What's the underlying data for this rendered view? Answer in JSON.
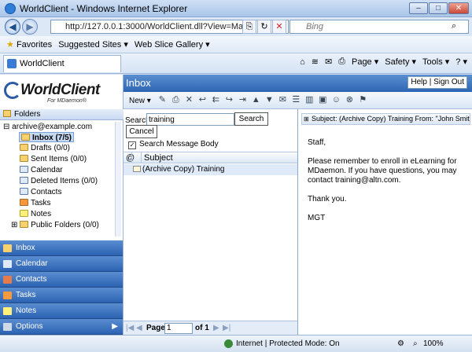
{
  "window": {
    "title": "WorldClient - Windows Internet Explorer",
    "min": "–",
    "max": "□",
    "close": "✕"
  },
  "address": {
    "url": "http://127.0.0.1:3000/WorldClient.dll?View=Main",
    "search_placeholder": "Bing"
  },
  "favorites": {
    "label": "Favorites",
    "items": [
      "Suggested Sites ▾",
      "Web Slice Gallery ▾"
    ]
  },
  "tab": {
    "title": "WorldClient"
  },
  "ie_tools": {
    "page": "Page ▾",
    "safety": "Safety ▾",
    "tools": "Tools ▾",
    "help": "? ▾"
  },
  "app": {
    "logo": "WorldClient",
    "logo_sub": "For MDaemon®",
    "header": "Inbox",
    "help_signout": "Help | Sign Out",
    "toolbar": {
      "new": "New ▾"
    },
    "folders_label": "Folders",
    "account": "archive@example.com",
    "folders": [
      "Inbox (7/5)",
      "Drafts (0/0)",
      "Sent Items (0/0)",
      "Calendar",
      "Deleted Items (0/0)",
      "Contacts",
      "Tasks",
      "Notes",
      "Public Folders (0/0)"
    ],
    "nav": [
      "Inbox",
      "Calendar",
      "Contacts",
      "Tasks",
      "Notes",
      "Options"
    ],
    "search": {
      "label": "Search",
      "value": "training",
      "button": "Search",
      "cancel": "Cancel",
      "body_option": "Search Message Body"
    },
    "columns": {
      "attach": "@",
      "subject": "Subject"
    },
    "messages": [
      {
        "subject": "(Archive Copy) Training"
      }
    ],
    "pager": {
      "page_label": "Page",
      "page": "1",
      "of": "of 1"
    },
    "preview": {
      "header": "Subject: (Archive Copy) Training From: \"John Smith",
      "greeting": "Staff,",
      "body": "Please remember to enroll in eLearning for MDaemon. If you have questions, you may contact training@altn.com.",
      "thanks": "Thank you.",
      "signature": "MGT"
    }
  },
  "status": {
    "zone": "Internet | Protected Mode: On",
    "zoom": "100%"
  }
}
